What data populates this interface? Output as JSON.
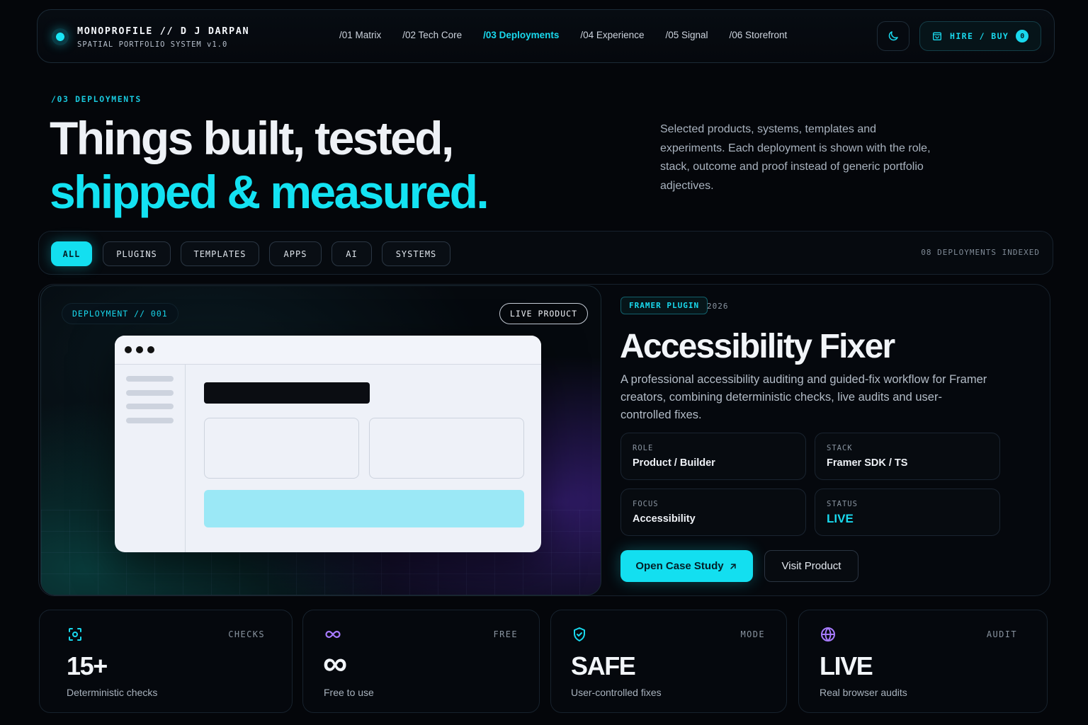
{
  "header": {
    "brand_title": "MONOPROFILE // D J DARPAN",
    "brand_subtitle": "SPATIAL PORTFOLIO SYSTEM v1.0",
    "nav": [
      {
        "label": "/01 Matrix",
        "active": false
      },
      {
        "label": "/02 Tech Core",
        "active": false
      },
      {
        "label": "/03 Deployments",
        "active": true
      },
      {
        "label": "/04 Experience",
        "active": false
      },
      {
        "label": "/05 Signal",
        "active": false
      },
      {
        "label": "/06 Storefront",
        "active": false
      }
    ],
    "theme_icon": "moon-icon",
    "hire_label": "HIRE / BUY",
    "hire_icon": "cart-icon",
    "cart_count": "0"
  },
  "hero": {
    "section_label": "/03 DEPLOYMENTS",
    "title_line1": "Things built, tested,",
    "title_line2": "shipped & measured.",
    "description": "Selected products, systems, templates and experiments. Each deployment is shown with the role, stack, outcome and proof instead of generic portfolio adjectives."
  },
  "filters": {
    "items": [
      {
        "label": "ALL",
        "active": true
      },
      {
        "label": "PLUGINS",
        "active": false
      },
      {
        "label": "TEMPLATES",
        "active": false
      },
      {
        "label": "APPS",
        "active": false
      },
      {
        "label": "AI",
        "active": false
      },
      {
        "label": "SYSTEMS",
        "active": false
      }
    ],
    "indexed_label": "08 DEPLOYMENTS INDEXED"
  },
  "deployment": {
    "id_label": "DEPLOYMENT // 001",
    "live_label": "LIVE PRODUCT",
    "category": "FRAMER PLUGIN",
    "year": "2026",
    "title": "Accessibility Fixer",
    "description": "A professional accessibility auditing and guided-fix workflow for Framer creators, combining deterministic checks, live audits and user-controlled fixes.",
    "meta": {
      "role_label": "ROLE",
      "role_value": "Product / Builder",
      "stack_label": "STACK",
      "stack_value": "Framer SDK / TS",
      "focus_label": "FOCUS",
      "focus_value": "Accessibility",
      "status_label": "STATUS",
      "status_value": "LIVE"
    },
    "primary_cta": "Open Case Study",
    "primary_cta_icon": "arrow-up-right-icon",
    "secondary_cta": "Visit Product"
  },
  "stats": [
    {
      "icon": "scan-icon",
      "key": "CHECKS",
      "value": "15+",
      "caption": "Deterministic checks"
    },
    {
      "icon": "infinity-icon",
      "key": "FREE",
      "value": "∞",
      "caption": "Free to use"
    },
    {
      "icon": "shield-check-icon",
      "key": "MODE",
      "value": "SAFE",
      "caption": "User-controlled fixes"
    },
    {
      "icon": "globe-icon",
      "key": "AUDIT",
      "value": "LIVE",
      "caption": "Real browser audits"
    }
  ],
  "colors": {
    "accent": "#13dff0",
    "accent_purple": "#a77bff",
    "background": "#04060a"
  }
}
